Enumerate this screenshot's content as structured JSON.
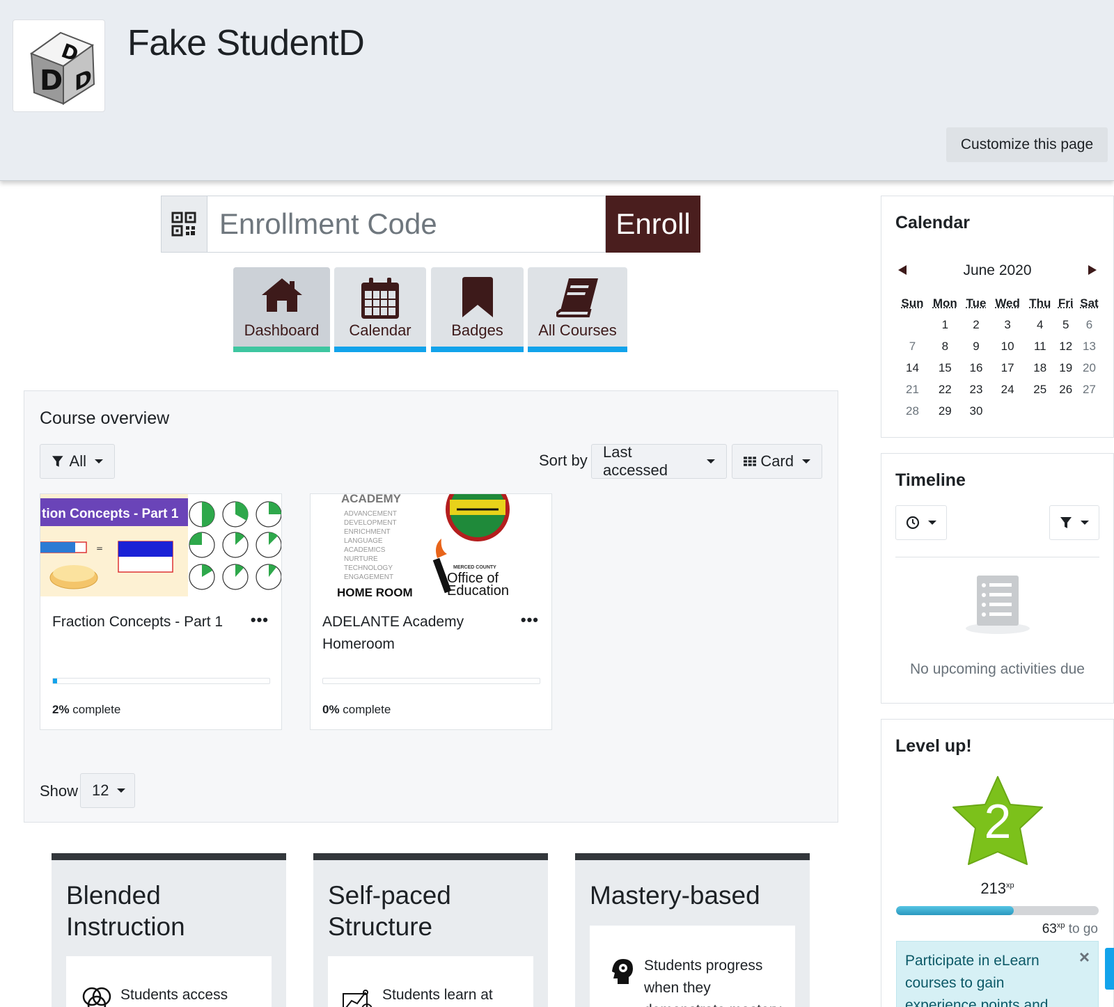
{
  "header": {
    "title": "Fake StudentD",
    "customize_label": "Customize this page"
  },
  "enroll": {
    "placeholder": "Enrollment Code",
    "button_label": "Enroll",
    "qr_icon": "qrcode-icon"
  },
  "nav": {
    "tiles": [
      {
        "label": "Dashboard",
        "icon": "home-icon"
      },
      {
        "label": "Calendar",
        "icon": "calendar-icon"
      },
      {
        "label": "Badges",
        "icon": "bookmark-icon"
      },
      {
        "label": "All Courses",
        "icon": "book-icon"
      }
    ],
    "active": "Dashboard",
    "active_color": "#3ec6a0",
    "bar_color": "#12a3eb"
  },
  "overview": {
    "title": "Course overview",
    "filter_label": "All",
    "sort_label": "Sort by",
    "sort_value": "Last accessed",
    "view_value": "Card",
    "show_label": "Show",
    "show_value": "12",
    "courses": [
      {
        "name": "Fraction Concepts - Part 1",
        "image_text": "tion Concepts - Part 1",
        "progress": 2,
        "progress_pct": "2%",
        "progress_suffix": " complete"
      },
      {
        "name": "ADELANTE Academy Homeroom",
        "image_heading": "ACADEMY",
        "image_lines": [
          "ADVANCEMENT",
          "DEVELOPMENT",
          "ENRICHMENT",
          "LANGUAGE",
          "ACADEMICS",
          "NURTURE",
          "TECHNOLOGY",
          "ENGAGEMENT"
        ],
        "image_footer": "HOME ROOM",
        "image_seal_top": "MERCED COUNTY",
        "image_seal_line1": "Office of",
        "image_seal_line2": "Education",
        "progress": 0,
        "progress_pct": "0%",
        "progress_suffix": " complete"
      }
    ]
  },
  "features": [
    {
      "title": "Blended Instruction",
      "text": "Students access",
      "icon": "venn-icon"
    },
    {
      "title": "Self-paced Structure",
      "text": "Students learn at",
      "icon": "chart-icon"
    },
    {
      "title": "Mastery-based",
      "text": "Students progress when they demonstrate mastery",
      "icon": "brain-gear-icon"
    }
  ],
  "calendar": {
    "title": "Calendar",
    "month": "June 2020",
    "weekdays": [
      "Sun",
      "Mon",
      "Tue",
      "Wed",
      "Thu",
      "Fri",
      "Sat"
    ],
    "weeks": [
      [
        "",
        "1",
        "2",
        "3",
        "4",
        "5",
        "6"
      ],
      [
        "7",
        "8",
        "9",
        "10",
        "11",
        "12",
        "13"
      ],
      [
        "14",
        "15",
        "16",
        "17",
        "18",
        "19",
        "20"
      ],
      [
        "21",
        "22",
        "23",
        "24",
        "25",
        "26",
        "27"
      ],
      [
        "28",
        "29",
        "30",
        "",
        "",
        "",
        ""
      ]
    ]
  },
  "timeline": {
    "title": "Timeline",
    "empty_text": "No upcoming activities due"
  },
  "levelup": {
    "title": "Level up!",
    "level": "2",
    "xp": "213",
    "xp_unit": "xp",
    "xp_to_go": "63",
    "to_go_label": "to go",
    "progress": 0.58,
    "message": "Participate in eLearn courses to gain experience points and level up!",
    "star_color": "#7cc11b"
  }
}
